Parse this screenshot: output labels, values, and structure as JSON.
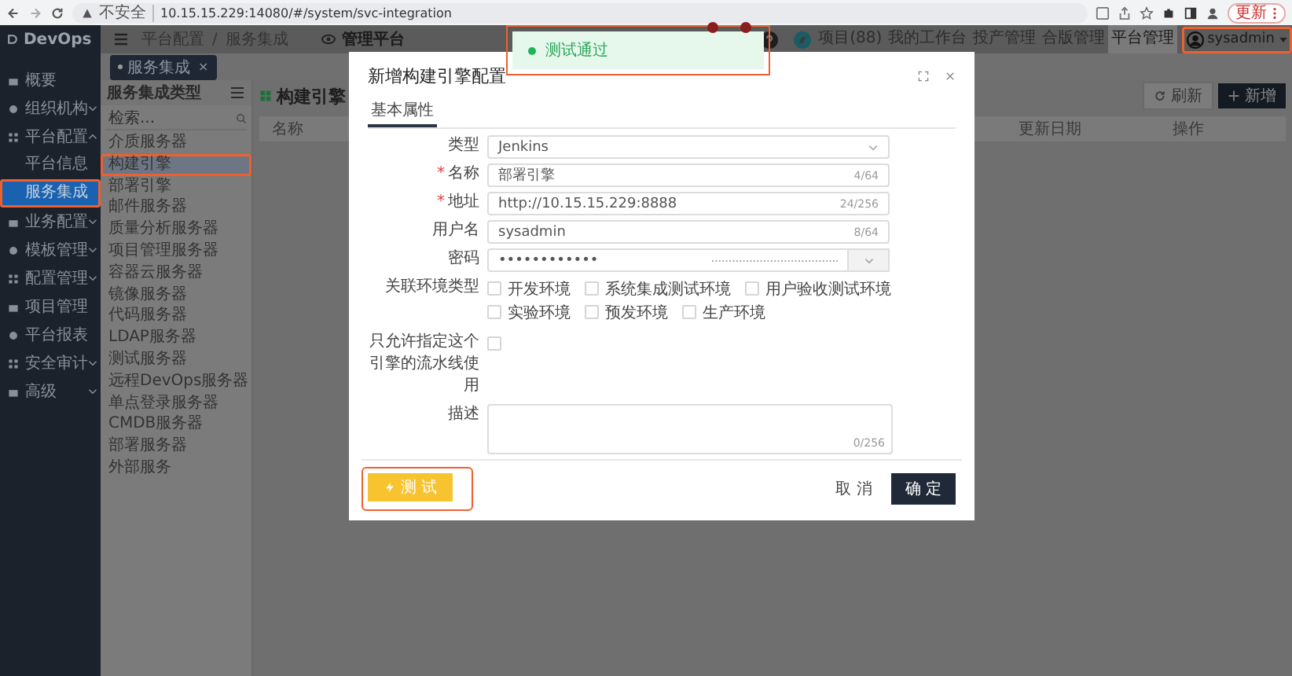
{
  "browser": {
    "security": "不安全",
    "url": "10.15.15.229:14080/#/system/svc-integration",
    "update_button": "更新"
  },
  "header": {
    "logo": "DevOps",
    "breadcrumb": [
      "平台配置",
      "服务集成"
    ],
    "breadcrumb_separator": "/",
    "platform": "管理平台",
    "nav": [
      {
        "label": "项目(88)",
        "selected": false
      },
      {
        "label": "我的工作台",
        "selected": false
      },
      {
        "label": "投产管理",
        "selected": false
      },
      {
        "label": "合版管理",
        "selected": false
      },
      {
        "label": "平台管理",
        "selected": true
      }
    ],
    "user": {
      "name": "sysadmin",
      "highlighted": true
    }
  },
  "sidebar": {
    "items": [
      {
        "label": "概要",
        "kind": "link"
      },
      {
        "label": "组织机构",
        "kind": "group",
        "expanded": false
      },
      {
        "label": "平台配置",
        "kind": "group",
        "expanded": true,
        "children": [
          {
            "label": "平台信息",
            "selected": false,
            "highlighted": false
          },
          {
            "label": "服务集成",
            "selected": true,
            "highlighted": true
          }
        ]
      },
      {
        "label": "业务配置",
        "kind": "group",
        "expanded": false
      },
      {
        "label": "模板管理",
        "kind": "group",
        "expanded": false
      },
      {
        "label": "配置管理",
        "kind": "group",
        "expanded": false
      },
      {
        "label": "项目管理",
        "kind": "link"
      },
      {
        "label": "平台报表",
        "kind": "link"
      },
      {
        "label": "安全审计",
        "kind": "group",
        "expanded": false
      },
      {
        "label": "高级",
        "kind": "group",
        "expanded": false
      }
    ]
  },
  "page_tab": {
    "label": "服务集成",
    "close": "×"
  },
  "service_types": {
    "title": "服务集成类型",
    "search_placeholder": "检索...",
    "items": [
      {
        "label": "介质服务器",
        "selected": false,
        "highlighted": false
      },
      {
        "label": "构建引擎",
        "selected": true,
        "highlighted": true
      },
      {
        "label": "部署引擎",
        "selected": false,
        "highlighted": false
      },
      {
        "label": "邮件服务器",
        "selected": false,
        "highlighted": false
      },
      {
        "label": "质量分析服务器",
        "selected": false,
        "highlighted": false
      },
      {
        "label": "项目管理服务器",
        "selected": false,
        "highlighted": false
      },
      {
        "label": "容器云服务器",
        "selected": false,
        "highlighted": false
      },
      {
        "label": "镜像服务器",
        "selected": false,
        "highlighted": false
      },
      {
        "label": "代码服务器",
        "selected": false,
        "highlighted": false
      },
      {
        "label": "LDAP服务器",
        "selected": false,
        "highlighted": false
      },
      {
        "label": "测试服务器",
        "selected": false,
        "highlighted": false
      },
      {
        "label": "远程DevOps服务器",
        "selected": false,
        "highlighted": false
      },
      {
        "label": "单点登录服务器",
        "selected": false,
        "highlighted": false
      },
      {
        "label": "CMDB服务器",
        "selected": false,
        "highlighted": false
      },
      {
        "label": "部署服务器",
        "selected": false,
        "highlighted": false
      },
      {
        "label": "外部服务",
        "selected": false,
        "highlighted": false
      }
    ]
  },
  "content": {
    "title": "构建引擎",
    "refresh_button": "刷新",
    "add_button": "新增",
    "columns": [
      "名称",
      "更新日期",
      "操作"
    ]
  },
  "toast": {
    "message": "测试通过",
    "highlighted": true
  },
  "modal": {
    "title": "新增构建引擎配置",
    "required_mark": "*",
    "tabs": [
      {
        "label": "基本属性",
        "selected": true
      }
    ],
    "fields": [
      {
        "kind": "select",
        "label": "类型",
        "required": false,
        "value": "Jenkins"
      },
      {
        "kind": "text",
        "label": "名称",
        "required": true,
        "value": "部署引擎",
        "counter": "4/64"
      },
      {
        "kind": "text",
        "label": "地址",
        "required": true,
        "value": "http://10.15.15.229:8888",
        "counter": "24/256"
      },
      {
        "kind": "text",
        "label": "用户名",
        "required": false,
        "value": "sysadmin",
        "counter": "8/64"
      },
      {
        "kind": "password",
        "label": "密码",
        "required": false,
        "value": "••••••••••••"
      },
      {
        "kind": "checkboxes",
        "label": "关联环境类型",
        "required": false,
        "options": [
          {
            "label": "开发环境",
            "checked": false
          },
          {
            "label": "系统集成测试环境",
            "checked": false
          },
          {
            "label": "用户验收测试环境",
            "checked": false
          },
          {
            "label": "实验环境",
            "checked": false
          },
          {
            "label": "预发环境",
            "checked": false
          },
          {
            "label": "生产环境",
            "checked": false
          }
        ]
      },
      {
        "kind": "checkbox",
        "label": "只允许指定这个引擎的流水线使用",
        "required": false,
        "checked": false
      },
      {
        "kind": "textarea",
        "label": "描述",
        "required": false,
        "counter": "0/256"
      }
    ],
    "test_button": {
      "label": "测 试",
      "highlighted": true
    },
    "cancel_button": "取 消",
    "confirm_button": "确 定"
  }
}
